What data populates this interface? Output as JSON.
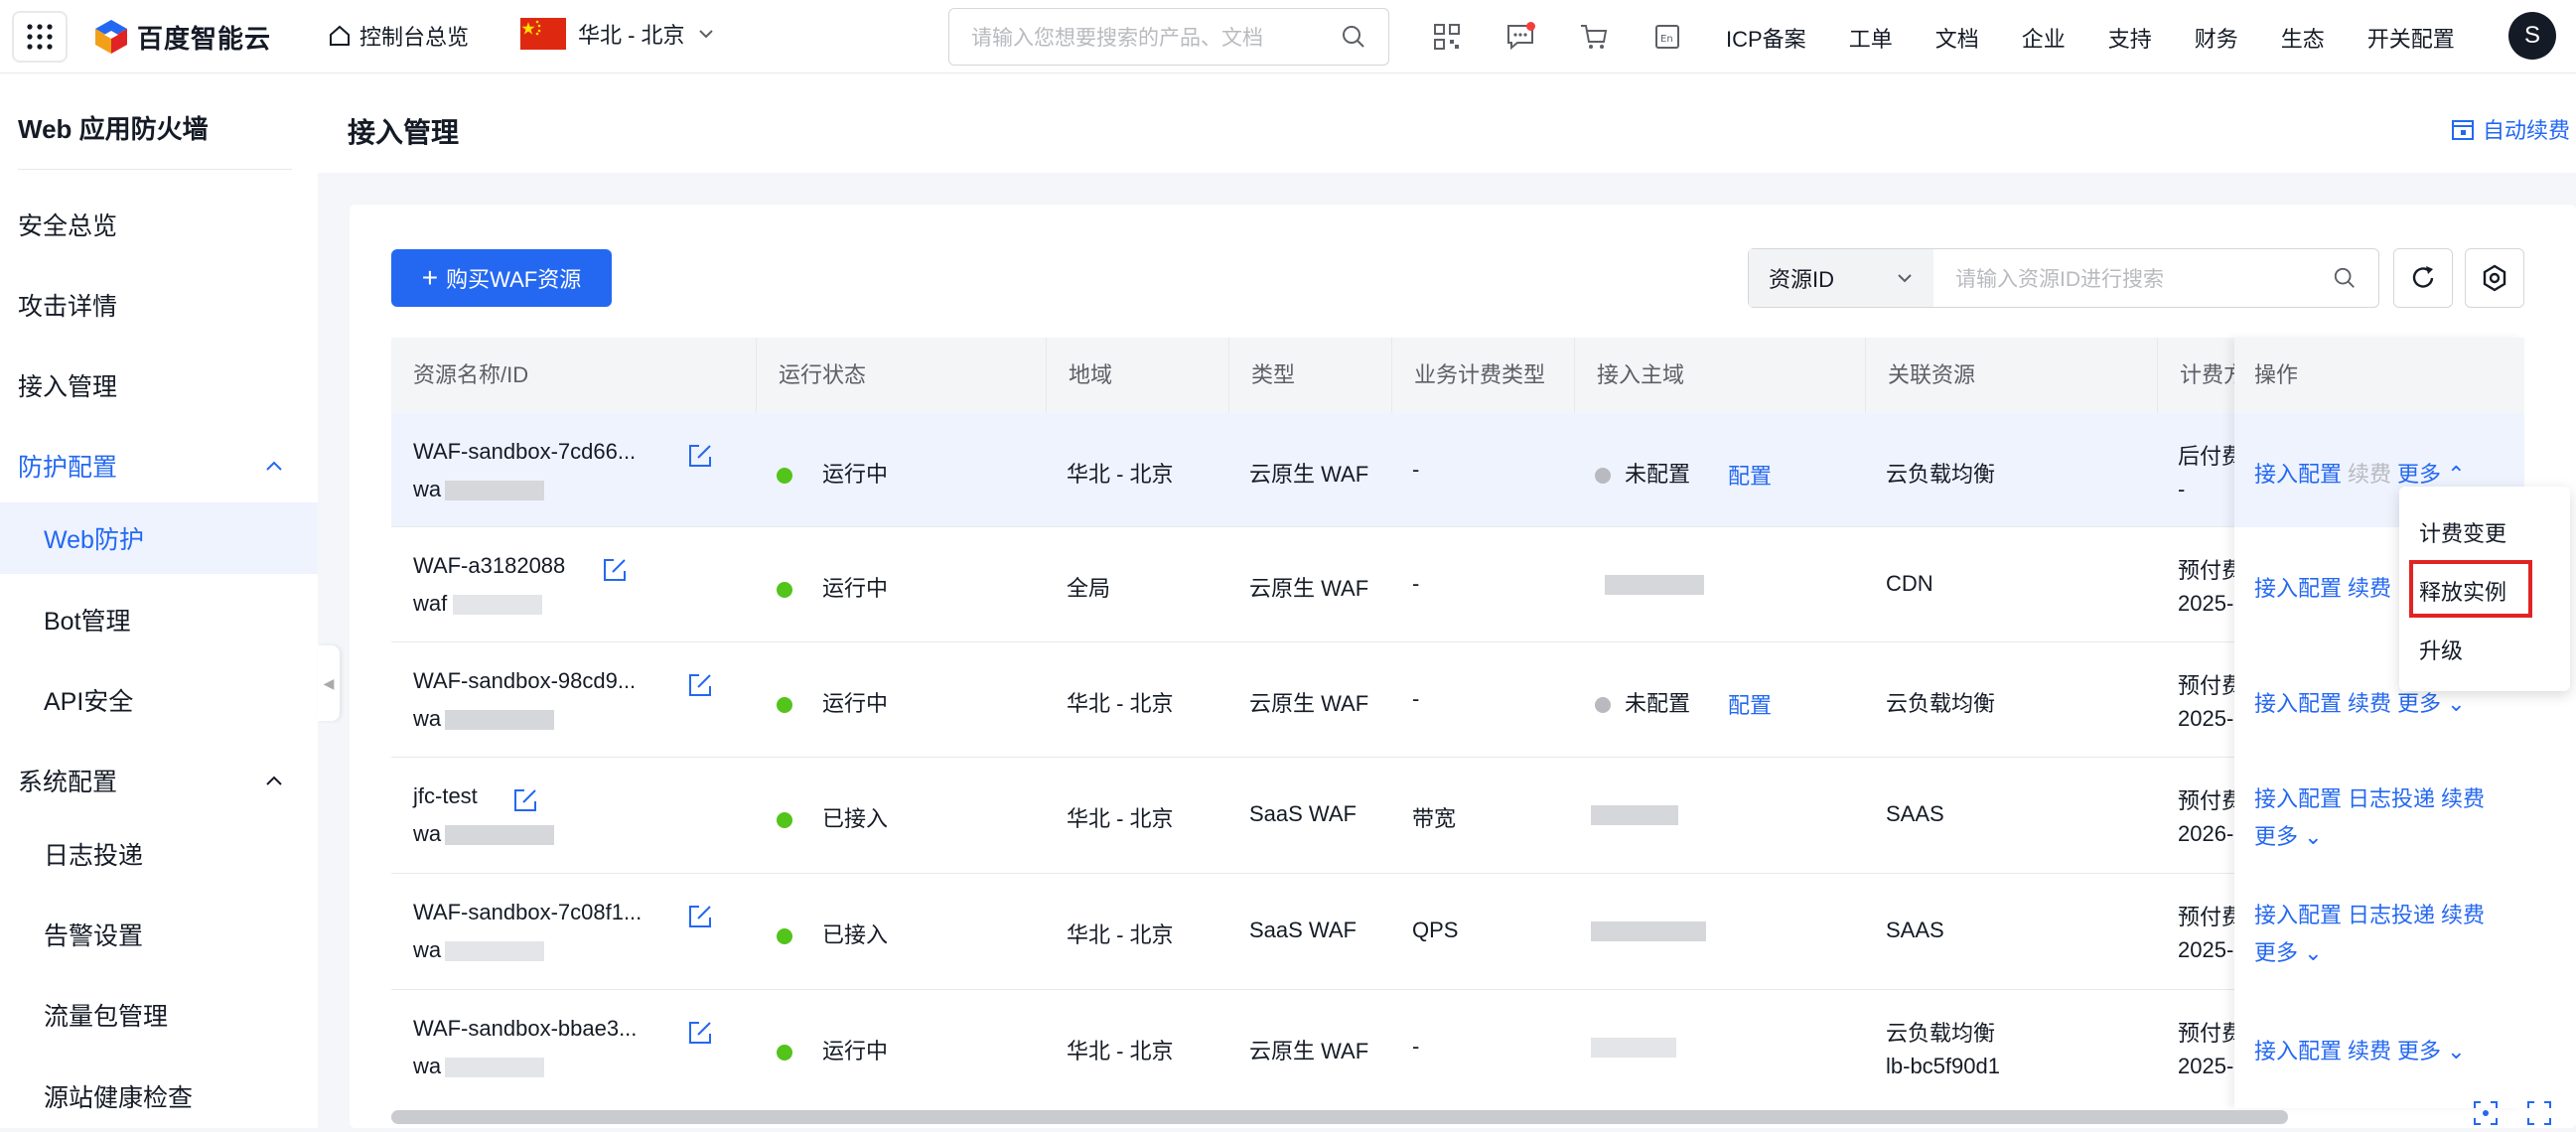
{
  "topbar": {
    "logo": "百度智能云",
    "home": "控制台总览",
    "region": "华北 - 北京",
    "search_placeholder": "请输入您想要搜索的产品、文档",
    "nav": [
      "ICP备案",
      "工单",
      "文档",
      "企业",
      "支持",
      "财务",
      "生态",
      "开关配置"
    ],
    "avatar": "S"
  },
  "sidebar": {
    "title": "Web 应用防火墙",
    "items": [
      "安全总览",
      "攻击详情",
      "接入管理"
    ],
    "group1": "防护配置",
    "group1_items": [
      "Web防护",
      "Bot管理",
      "API安全"
    ],
    "group2": "系统配置",
    "group2_items": [
      "日志投递",
      "告警设置",
      "流量包管理",
      "源站健康检查"
    ]
  },
  "header": {
    "title": "接入管理",
    "auto_renew": "自动续费"
  },
  "toolbar": {
    "buy": "购买WAF资源",
    "filter_select": "资源ID",
    "filter_placeholder": "请输入资源ID进行搜索"
  },
  "table": {
    "columns": [
      "资源名称/ID",
      "运行状态",
      "地域",
      "类型",
      "业务计费类型",
      "接入主域",
      "关联资源",
      "计费方",
      "操作"
    ],
    "rows": [
      {
        "name": "WAF-sandbox-7cd66...",
        "id": "wa",
        "status": "运行中",
        "region": "华北 - 北京",
        "type": "云原生 WAF",
        "billing": "-",
        "domain": "未配置",
        "domain_link": "配置",
        "resource": "云负载均衡",
        "resource2": "",
        "pay": "后付费",
        "pay2": "-",
        "ops": [
          "接入配置",
          "续费",
          "更多"
        ]
      },
      {
        "name": "WAF-a3182088",
        "id": "waf",
        "status": "运行中",
        "region": "全局",
        "type": "云原生 WAF",
        "billing": "-",
        "domain": "",
        "domain_link": "",
        "resource": "CDN",
        "resource2": "",
        "pay": "预付费",
        "pay2": "2025-",
        "ops": [
          "接入配置",
          "续费"
        ]
      },
      {
        "name": "WAF-sandbox-98cd9...",
        "id": "wa",
        "status": "运行中",
        "region": "华北 - 北京",
        "type": "云原生 WAF",
        "billing": "-",
        "domain": "未配置",
        "domain_link": "配置",
        "resource": "云负载均衡",
        "resource2": "",
        "pay": "预付费",
        "pay2": "2025-",
        "ops": [
          "接入配置",
          "续费",
          "更多"
        ]
      },
      {
        "name": "jfc-test",
        "id": "wa",
        "status": "已接入",
        "region": "华北 - 北京",
        "type": "SaaS WAF",
        "billing": "带宽",
        "domain": "",
        "domain_link": "",
        "resource": "SAAS",
        "resource2": "",
        "pay": "预付费",
        "pay2": "2026-",
        "ops": [
          "接入配置",
          "日志投递",
          "续费",
          "更多"
        ]
      },
      {
        "name": "WAF-sandbox-7c08f1...",
        "id": "wa",
        "status": "已接入",
        "region": "华北 - 北京",
        "type": "SaaS WAF",
        "billing": "QPS",
        "domain": "",
        "domain_link": "",
        "resource": "SAAS",
        "resource2": "",
        "pay": "预付费",
        "pay2": "2025-",
        "ops": [
          "接入配置",
          "日志投递",
          "续费",
          "更多"
        ]
      },
      {
        "name": "WAF-sandbox-bbae3...",
        "id": "wa",
        "status": "运行中",
        "region": "华北 - 北京",
        "type": "云原生 WAF",
        "billing": "-",
        "domain": "",
        "domain_link": "",
        "resource": "云负载均衡",
        "resource2": "lb-bc5f90d1",
        "pay": "预付费",
        "pay2": "2025-",
        "ops": [
          "接入配置",
          "续费",
          "更多"
        ]
      }
    ]
  },
  "dropdown": {
    "items": [
      "计费变更",
      "释放实例",
      "升级"
    ],
    "highlighted": "释放实例"
  },
  "colors": {
    "accent": "#2468f2",
    "status_green": "#52c41a",
    "status_gray": "#b8babf",
    "highlight_red": "#e02424"
  }
}
